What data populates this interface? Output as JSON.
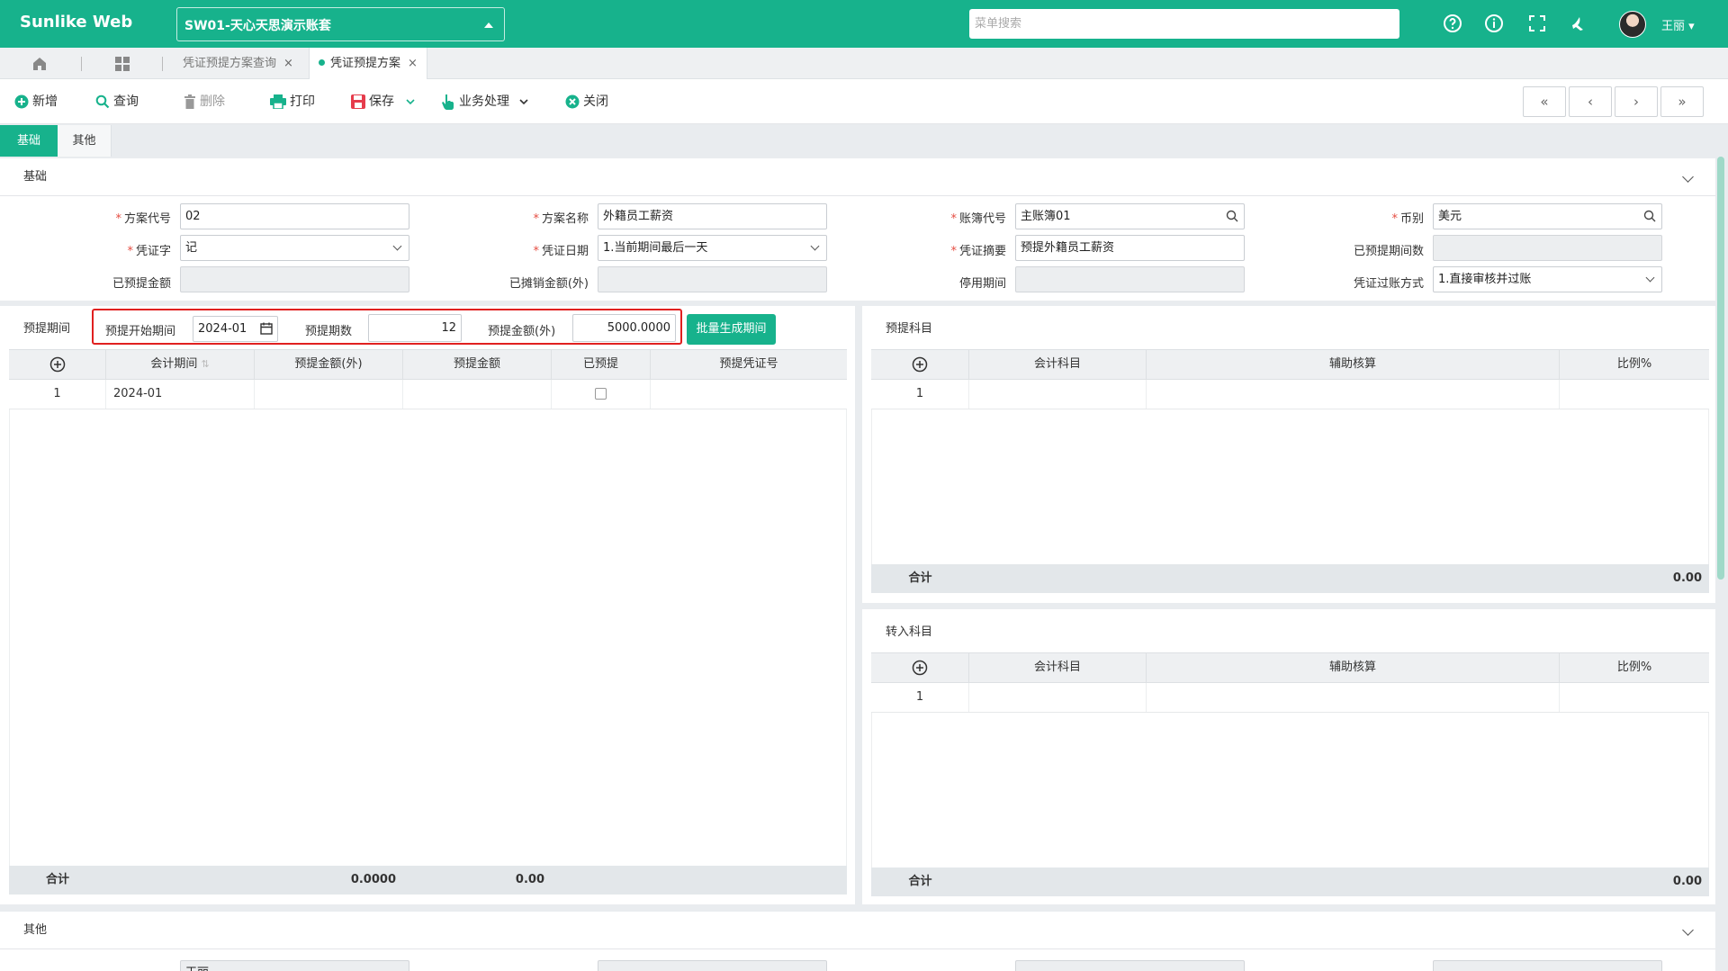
{
  "topbar": {
    "brand": "Sunlike Web",
    "account": "SW01-天心天思演示账套",
    "search_placeholder": "菜单搜索",
    "username": "王丽"
  },
  "tabs": {
    "tab1": "凭证预提方案查询",
    "tab2": "凭证预提方案"
  },
  "toolbar": {
    "new": "新增",
    "query": "查询",
    "delete": "删除",
    "print": "打印",
    "save": "保存",
    "business": "业务处理",
    "close": "关闭"
  },
  "subtabs": {
    "basic": "基础",
    "other": "其他"
  },
  "basic": {
    "title": "基础",
    "plan_code_label": "方案代号",
    "plan_code": "02",
    "plan_name_label": "方案名称",
    "plan_name": "外籍员工薪资",
    "ledger_label": "账簿代号",
    "ledger": "主账簿01",
    "currency_label": "币别",
    "currency": "美元",
    "voucher_word_label": "凭证字",
    "voucher_word": "记",
    "voucher_date_label": "凭证日期",
    "voucher_date": "1.当前期间最后一天",
    "voucher_summary_label": "凭证摘要",
    "voucher_summary": "预提外籍员工薪资",
    "accrued_periods_label": "已预提期间数",
    "accrued_amount_label": "已预提金额",
    "amortized_label": "已摊销金额(外)",
    "disable_period_label": "停用期间",
    "posting_label": "凭证过账方式",
    "posting": "1.直接审核并过账"
  },
  "period": {
    "title": "预提期间",
    "start_label": "预提开始期间",
    "start": "2024-01",
    "count_label": "预提期数",
    "count": "12",
    "amount_label": "预提金额(外)",
    "amount": "5000.0000",
    "gen_button": "批量生成期间",
    "columns": [
      "会计期间",
      "预提金额(外)",
      "预提金额",
      "已预提",
      "预提凭证号"
    ],
    "rows": [
      {
        "no": "1",
        "period": "2024-01"
      }
    ],
    "total_label": "合计",
    "total_fx": "0.0000",
    "total": "0.00"
  },
  "accrual_accounts": {
    "title": "预提科目",
    "columns": [
      "会计科目",
      "辅助核算",
      "比例%"
    ],
    "row_no": "1",
    "total_label": "合计",
    "total": "0.00"
  },
  "transfer_accounts": {
    "title": "转入科目",
    "columns": [
      "会计科目",
      "辅助核算",
      "比例%"
    ],
    "row_no": "1",
    "total_label": "合计",
    "total": "0.00"
  },
  "other": {
    "title": "其他",
    "creator": "王丽"
  }
}
